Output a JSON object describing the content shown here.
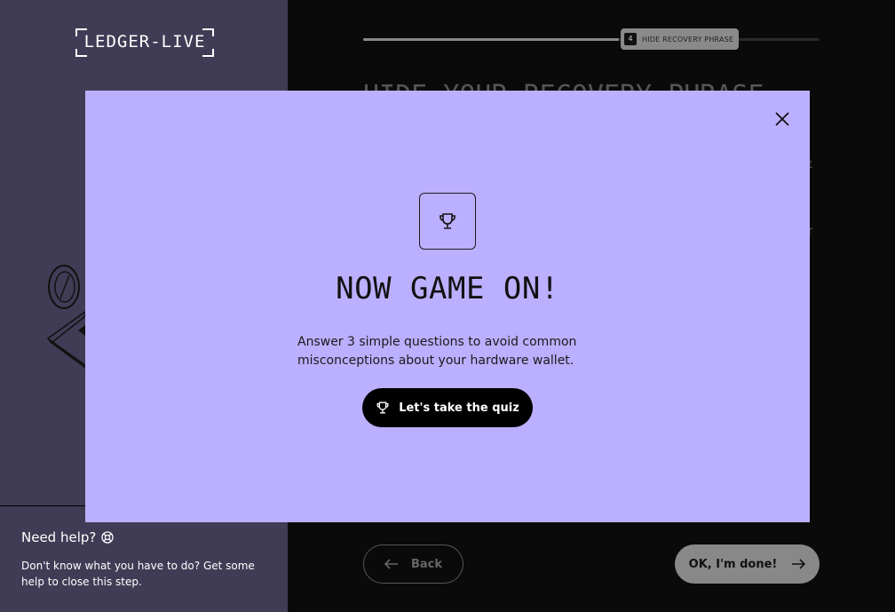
{
  "app": {
    "logo_text": "LEDGER-LIVE"
  },
  "sidebar": {
    "help_title": "Need help?",
    "help_icon": "lifebuoy-icon",
    "help_text": "Don't know what you have to do? Get some help to close this step."
  },
  "step": {
    "number": "4",
    "label": "HIDE RECOVERY PHRASE",
    "title": "HIDE YOUR RECOVERY PHRASE",
    "progress": 0.56,
    "ghost_1": "ot",
    "ghost_2": "or"
  },
  "footer": {
    "back_label": "Back",
    "done_label": "OK, I'm done!"
  },
  "modal": {
    "title": "NOW GAME ON!",
    "description": "Answer 3 simple questions to avoid common misconceptions about your hardware wallet.",
    "quiz_button_label": "Let's take the quiz",
    "icon": "trophy-icon",
    "close_icon": "close-icon"
  },
  "colors": {
    "modal_bg": "#bbb0ff",
    "sidebar_bg": "#413c55",
    "main_bg": "#0a0a0a"
  }
}
